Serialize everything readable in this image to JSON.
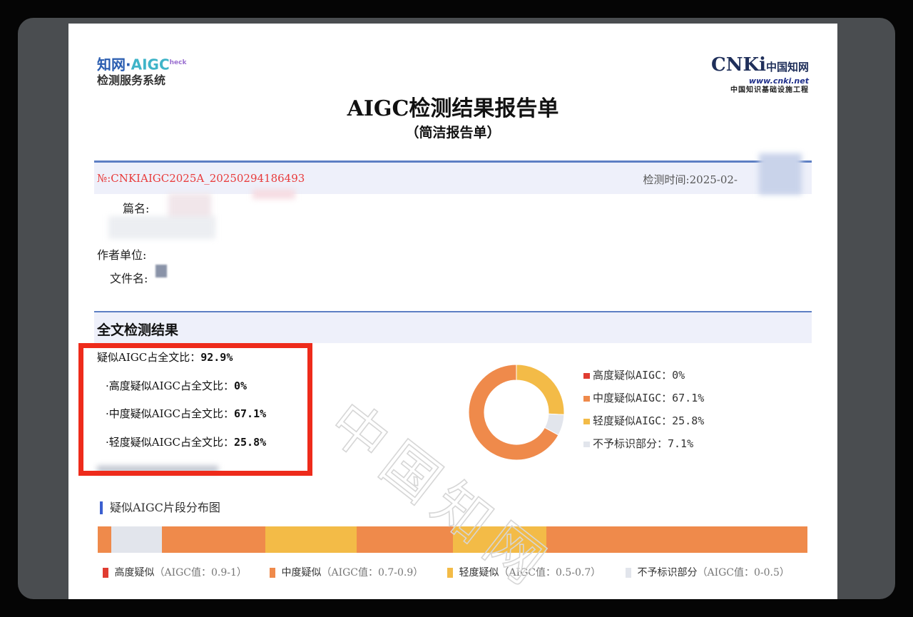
{
  "header": {
    "logo_left_line1_a": "知网·",
    "logo_left_line1_b": "AIGC",
    "logo_left_check": "heck",
    "logo_left_line2": "检测服务系统",
    "logo_right_main": "CNKi",
    "logo_right_cn": "中国知网",
    "logo_right_url": "www.cnki.net",
    "logo_right_sub": "中国知识基础设施工程"
  },
  "report": {
    "title": "AIGC检测结果报告单",
    "subtitle": "（简洁报告单）",
    "number": "№:CNKIAIGC2025A_20250294186493",
    "check_time": "检测时间:2025-02-"
  },
  "fields": {
    "title_label": "篇名:",
    "author_unit_label": "作者单位:",
    "file_name_label": "文件名:"
  },
  "section": {
    "title": "全文检测结果"
  },
  "results": {
    "total_label": "疑似AIGC占全文比：",
    "total_value": "92.9%",
    "high_label": "·高度疑似AIGC占全文比：",
    "high_value": "0%",
    "mid_label": "·中度疑似AIGC占全文比：",
    "mid_value": "67.1%",
    "low_label": "·轻度疑似AIGC占全文比：",
    "low_value": "25.8%"
  },
  "chart_data": {
    "type": "pie",
    "categories": [
      "高度疑似AIGC",
      "中度疑似AIGC",
      "轻度疑似AIGC",
      "不予标识部分"
    ],
    "values": [
      0,
      67.1,
      25.8,
      7.1
    ],
    "colors": [
      "#e03c31",
      "#ef8a4b",
      "#f3bb47",
      "#e2e5ec"
    ],
    "legend_labels": [
      "高度疑似AIGC：0%",
      "中度疑似AIGC：67.1%",
      "轻度疑似AIGC：25.8%",
      "不予标识部分：7.1%"
    ],
    "legend_position": "right",
    "donut": true
  },
  "distribution": {
    "title": "疑似AIGC片段分布图",
    "segments": [
      {
        "fraction": 0.019,
        "level": "mid"
      },
      {
        "fraction": 0.071,
        "level": "none"
      },
      {
        "fraction": 0.146,
        "level": "mid"
      },
      {
        "fraction": 0.129,
        "level": "low"
      },
      {
        "fraction": 0.136,
        "level": "mid"
      },
      {
        "fraction": 0.132,
        "level": "low"
      },
      {
        "fraction": 0.367,
        "level": "mid"
      }
    ],
    "legend": [
      {
        "name": "高度疑似",
        "range": "（AIGC值：0.9-1）",
        "color": "#e03c31"
      },
      {
        "name": "中度疑似",
        "range": "（AIGC值：0.7-0.9）",
        "color": "#ef8a4b"
      },
      {
        "name": "轻度疑似",
        "range": "（AIGC值：0.5-0.7）",
        "color": "#f3bb47"
      },
      {
        "name": "不予标识部分",
        "range": "（AIGC值：0-0.5）",
        "color": "#e2e5ec"
      }
    ]
  },
  "watermark": {
    "text": "中国知网"
  }
}
